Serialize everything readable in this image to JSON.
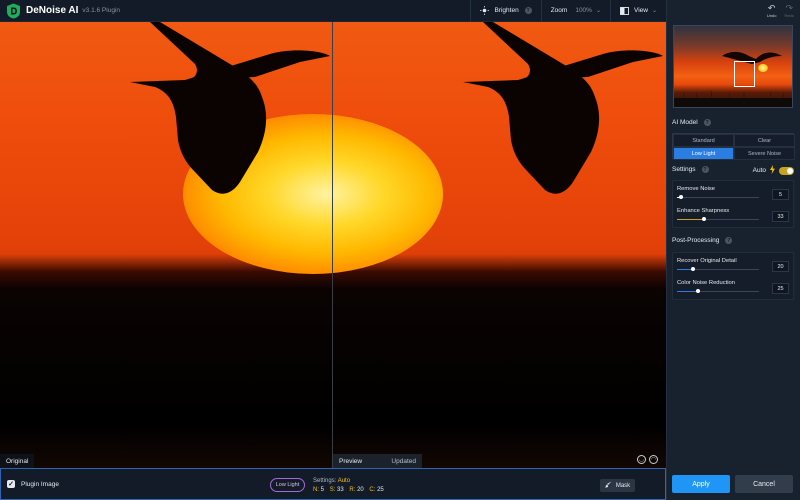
{
  "header": {
    "app_name": "DeNoise AI",
    "version": "v3.1.6 Plugin",
    "brighten_label": "Brighten",
    "zoom_label": "Zoom",
    "zoom_value": "100%",
    "view_label": "View",
    "logo_color": "#1fae5b"
  },
  "history": {
    "undo_label": "Undo",
    "redo_label": "Redo"
  },
  "panes": {
    "left_label": "Original",
    "preview_label": "Preview",
    "preview_status": "Updated"
  },
  "bottom": {
    "plugin_image_label": "Plugin Image",
    "plugin_image_checked": true,
    "model_pill": "Low Light",
    "settings_prefix": "Settings:",
    "settings_mode": "Auto",
    "summary": [
      {
        "key": "N:",
        "value": "5"
      },
      {
        "key": "S:",
        "value": "33"
      },
      {
        "key": "R:",
        "value": "20"
      },
      {
        "key": "C:",
        "value": "25"
      }
    ],
    "mask_label": "Mask"
  },
  "panel": {
    "ai_model_title": "AI Model",
    "models": [
      "Standard",
      "Clear",
      "Low Light",
      "Severe Noise"
    ],
    "active_model": "Low Light",
    "settings_title": "Settings",
    "auto_label": "Auto",
    "auto_on": true,
    "settings": [
      {
        "label": "Remove Noise",
        "value": "5",
        "fraction": 0.05,
        "color": "#ffffff"
      },
      {
        "label": "Enhance Sharpness",
        "value": "33",
        "fraction": 0.33,
        "color": "#c9a31f"
      }
    ],
    "post_title": "Post-Processing",
    "post": [
      {
        "label": "Recover Original Detail",
        "value": "20",
        "fraction": 0.2,
        "color": "#2a7de1"
      },
      {
        "label": "Color Noise Reduction",
        "value": "25",
        "fraction": 0.25,
        "color": "#2a7de1"
      }
    ]
  },
  "actions": {
    "apply_label": "Apply",
    "cancel_label": "Cancel",
    "apply_color": "#1f95f5"
  }
}
